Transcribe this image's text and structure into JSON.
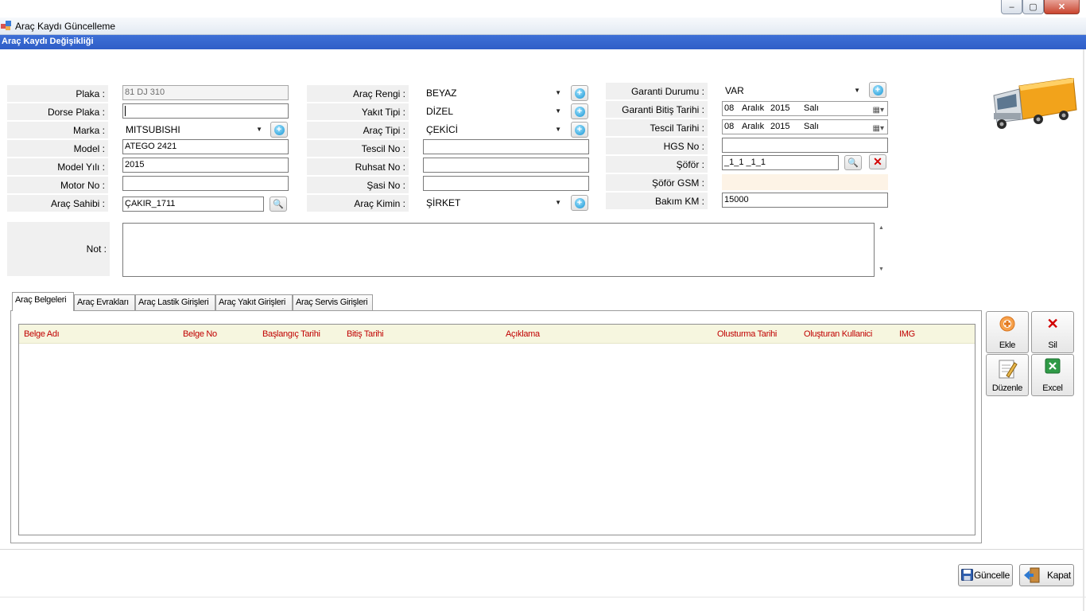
{
  "window": {
    "title": "Araç Kaydı Güncelleme",
    "banner": "Araç Kaydı Değişikliği",
    "min_glyph": "–",
    "max_glyph": "▢",
    "close_glyph": "✕"
  },
  "col1": {
    "plaka_label": "Plaka :",
    "plaka_value": "81 DJ 310",
    "dorse_label": "Dorse Plaka :",
    "dorse_value": "",
    "marka_label": "Marka :",
    "marka_value": "MITSUBISHI",
    "model_label": "Model :",
    "model_value": "ATEGO 2421",
    "modelyili_label": "Model Yılı :",
    "modelyili_value": "2015",
    "motor_label": "Motor No :",
    "motor_value": "",
    "sahip_label": "Araç Sahibi :",
    "sahip_value": "ÇAKIR_1711"
  },
  "col2": {
    "renk_label": "Araç Rengi :",
    "renk_value": "BEYAZ",
    "yakit_label": "Yakıt Tipi :",
    "yakit_value": "DİZEL",
    "tip_label": "Araç Tipi :",
    "tip_value": "ÇEKİCİ",
    "tescilno_label": "Tescil No :",
    "tescilno_value": "",
    "ruhsat_label": "Ruhsat No :",
    "ruhsat_value": "",
    "sasi_label": "Şasi No :",
    "sasi_value": "",
    "kimin_label": "Araç Kimin :",
    "kimin_value": "ŞİRKET"
  },
  "col3": {
    "garanti_label": "Garanti Durumu :",
    "garanti_value": "VAR",
    "garantibitis_label": "Garanti Bitiş Tarihi :",
    "garantibitis_date": {
      "day": "08",
      "month": "Aralık",
      "year": "2015",
      "weekday": "Salı"
    },
    "tescil_label": "Tescil Tarihi :",
    "tescil_date": {
      "day": "08",
      "month": "Aralık",
      "year": "2015",
      "weekday": "Salı"
    },
    "hgs_label": "HGS No :",
    "hgs_value": "",
    "sofor_label": "Şöför :",
    "sofor_value": "_1_1 _1_1",
    "soforgsm_label": "Şöför GSM :",
    "soforgsm_value": "",
    "bakim_label": "Bakım KM :",
    "bakim_value": "15000"
  },
  "not": {
    "label": "Not :",
    "value": ""
  },
  "tabs": [
    "Araç Belgeleri",
    "Araç Evrakları",
    "Araç Lastik Girişleri",
    "Araç Yakıt Girişleri",
    "Araç Servis Girişleri"
  ],
  "grid": {
    "columns": [
      "Belge Adı",
      "Belge No",
      "Başlangıç Tarihi",
      "Bitiş Tarihi",
      "Açıklama",
      "Olusturma Tarihi",
      "Oluşturan Kullanici",
      "IMG"
    ],
    "rows": []
  },
  "actions": {
    "ekle": "Ekle",
    "sil": "Sil",
    "duzenle": "Düzenle",
    "excel": "Excel"
  },
  "footer": {
    "guncelle": "Güncelle",
    "kapat": "Kapat"
  },
  "colors": {
    "banner": "#2f5ec7",
    "grid_header_bg": "#f6f6df",
    "grid_header_text": "#c00000",
    "gsm_field_bg": "#fdf3e6"
  }
}
